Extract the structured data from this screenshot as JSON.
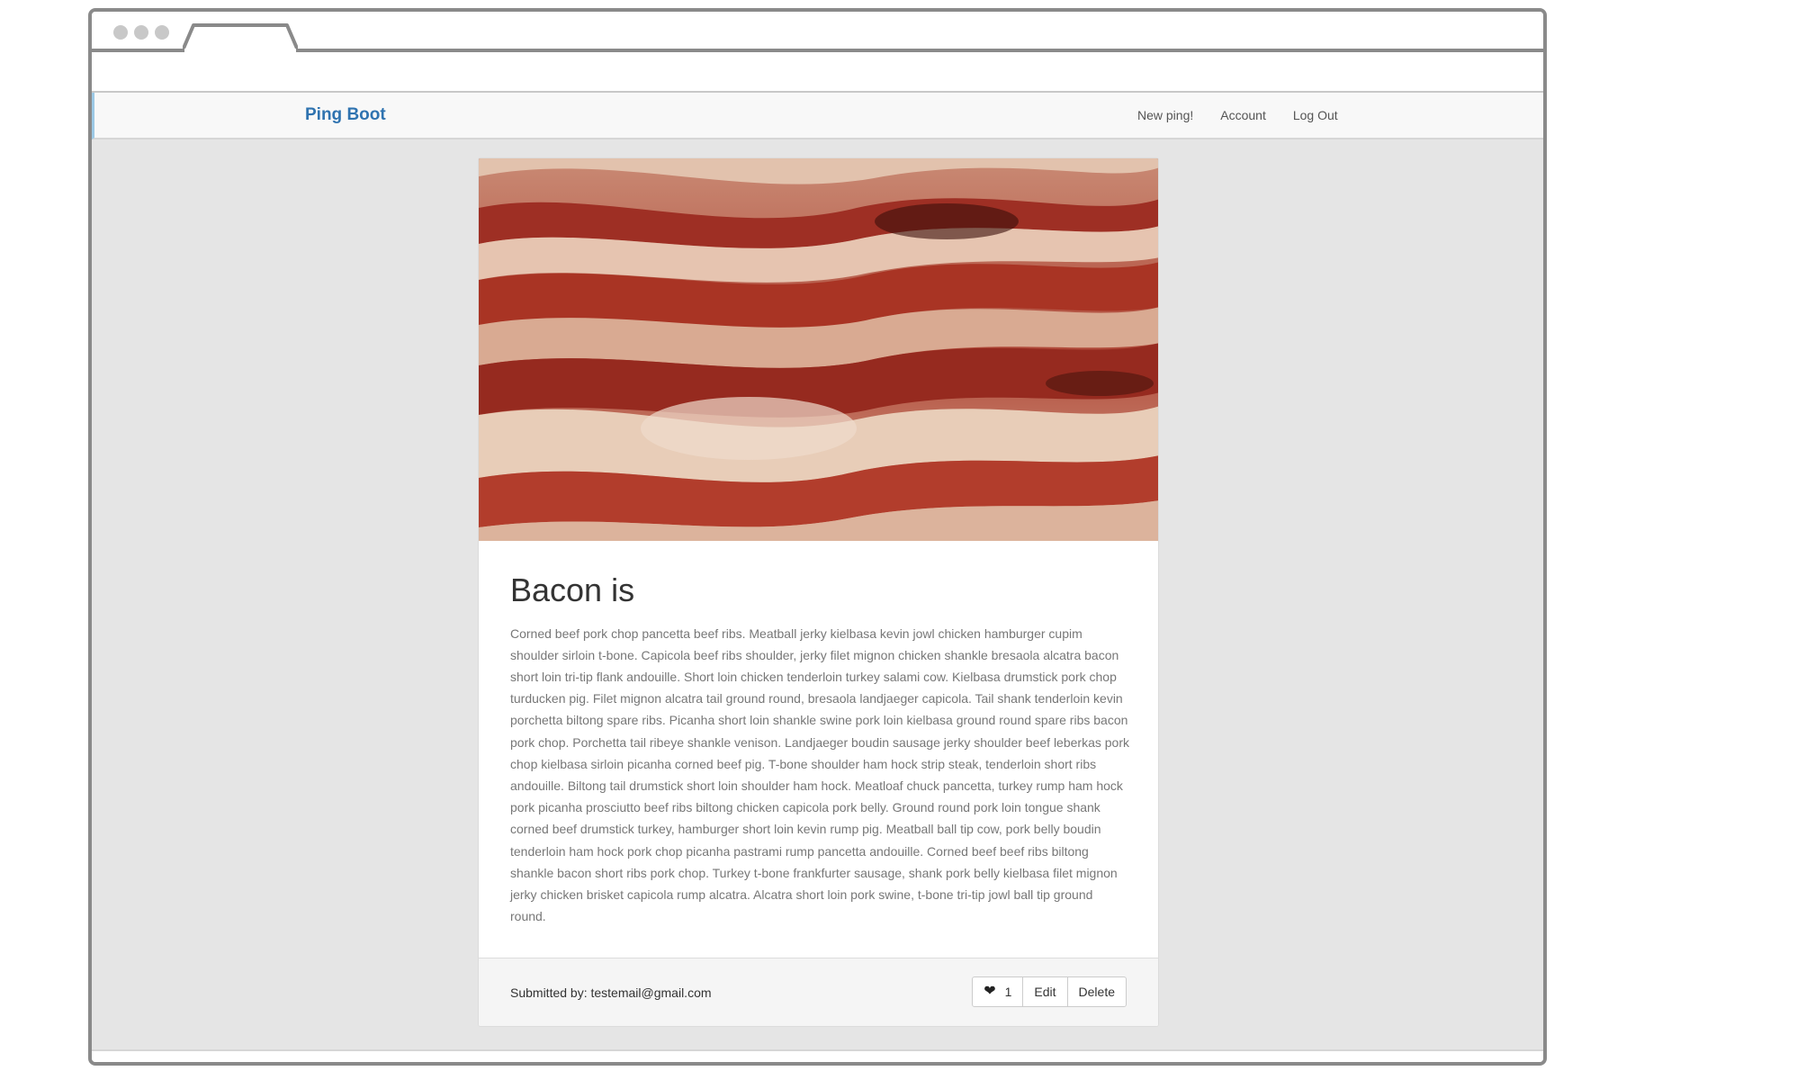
{
  "app": {
    "brand": "Ping Boot"
  },
  "nav": {
    "items": [
      {
        "label": "New ping!"
      },
      {
        "label": "Account"
      },
      {
        "label": "Log Out"
      }
    ]
  },
  "post": {
    "title": "Bacon is",
    "body": "Corned beef pork chop pancetta beef ribs. Meatball jerky kielbasa kevin jowl chicken hamburger cupim shoulder sirloin t-bone. Capicola beef ribs shoulder, jerky filet mignon chicken shankle bresaola alcatra bacon short loin tri-tip flank andouille. Short loin chicken tenderloin turkey salami cow. Kielbasa drumstick pork chop turducken pig. Filet mignon alcatra tail ground round, bresaola landjaeger capicola. Tail shank tenderloin kevin porchetta biltong spare ribs. Picanha short loin shankle swine pork loin kielbasa ground round spare ribs bacon pork chop. Porchetta tail ribeye shankle venison. Landjaeger boudin sausage jerky shoulder beef leberkas pork chop kielbasa sirloin picanha corned beef pig. T-bone shoulder ham hock strip steak, tenderloin short ribs andouille. Biltong tail drumstick short loin shoulder ham hock. Meatloaf chuck pancetta, turkey rump ham hock pork picanha prosciutto beef ribs biltong chicken capicola pork belly. Ground round pork loin tongue shank corned beef drumstick turkey, hamburger short loin kevin rump pig. Meatball ball tip cow, pork belly boudin tenderloin ham hock pork chop picanha pastrami rump pancetta andouille. Corned beef beef ribs biltong shankle bacon short ribs pork chop. Turkey t-bone frankfurter sausage, shank pork belly kielbasa filet mignon jerky chicken brisket capicola rump alcatra. Alcatra short loin pork swine, t-bone tri-tip jowl ball tip ground round.",
    "submitted_by": "Submitted by: testemail@gmail.com",
    "like_count": "1",
    "edit_label": "Edit",
    "delete_label": "Delete",
    "like_icon": "heart-icon",
    "image_subject": "bacon-photo"
  },
  "colors": {
    "brand": "#2f73b0",
    "page_bg": "#e5e5e5",
    "navbar_bg": "#f8f8f8"
  }
}
